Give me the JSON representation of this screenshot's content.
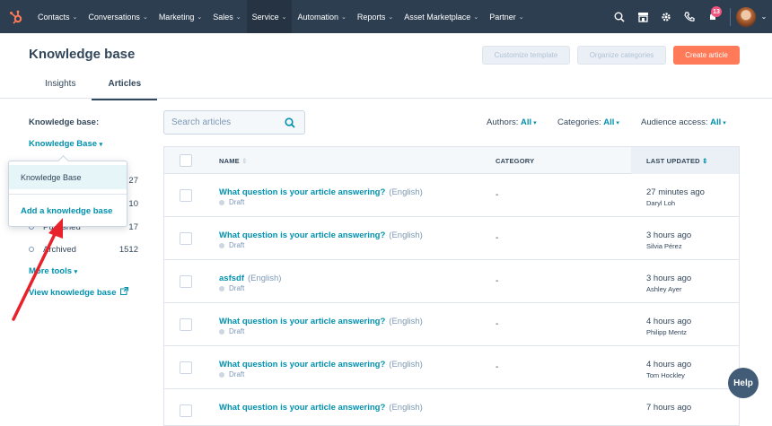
{
  "nav": {
    "items": [
      {
        "label": "Contacts"
      },
      {
        "label": "Conversations"
      },
      {
        "label": "Marketing"
      },
      {
        "label": "Sales"
      },
      {
        "label": "Service"
      },
      {
        "label": "Automation"
      },
      {
        "label": "Reports"
      },
      {
        "label": "Asset Marketplace"
      },
      {
        "label": "Partner"
      }
    ],
    "notification_count": "13"
  },
  "header": {
    "title": "Knowledge base",
    "customize_label": "Customize template",
    "organize_label": "Organize categories",
    "create_label": "Create article"
  },
  "tabs": [
    {
      "label": "Insights"
    },
    {
      "label": "Articles"
    }
  ],
  "sidebar": {
    "kb_label": "Knowledge base:",
    "kb_selected": "Knowledge Base",
    "rows": [
      {
        "label": "",
        "count": "27"
      },
      {
        "label": "",
        "count": "10"
      },
      {
        "label": "Published",
        "count": "17"
      },
      {
        "label": "Archived",
        "count": "1512"
      }
    ],
    "more_tools": "More tools",
    "view_kb": "View knowledge base"
  },
  "dropdown": {
    "item1": "Knowledge Base",
    "item2": "Add a knowledge base"
  },
  "search": {
    "placeholder": "Search articles"
  },
  "filters": {
    "authors_label": "Authors:",
    "authors_value": "All",
    "categories_label": "Categories:",
    "categories_value": "All",
    "audience_label": "Audience access:",
    "audience_value": "All"
  },
  "table": {
    "headers": {
      "name": "NAME",
      "category": "CATEGORY",
      "updated": "LAST UPDATED"
    },
    "rows": [
      {
        "title": "What question is your article answering?",
        "lang": "(English)",
        "status": "Draft",
        "category": "-",
        "time": "27 minutes ago",
        "author": "Daryl Loh"
      },
      {
        "title": "What question is your article answering?",
        "lang": "(English)",
        "status": "Draft",
        "category": "-",
        "time": "3 hours ago",
        "author": "Silvia Pérez"
      },
      {
        "title": "asfsdf",
        "lang": "(English)",
        "status": "Draft",
        "category": "-",
        "time": "3 hours ago",
        "author": "Ashley Ayer"
      },
      {
        "title": "What question is your article answering?",
        "lang": "(English)",
        "status": "Draft",
        "category": "-",
        "time": "4 hours ago",
        "author": "Philipp Mentz"
      },
      {
        "title": "What question is your article answering?",
        "lang": "(English)",
        "status": "Draft",
        "category": "-",
        "time": "4 hours ago",
        "author": "Tom Hockley"
      },
      {
        "title": "What question is your article answering?",
        "lang": "(English)",
        "status": "",
        "category": "",
        "time": "7 hours ago",
        "author": ""
      }
    ]
  },
  "help": {
    "label": "Help"
  },
  "colors": {
    "accent": "#0091ae",
    "nav_bg": "#2d3e50",
    "primary_button": "#ff7a59",
    "annotation_arrow": "#e8222b"
  }
}
